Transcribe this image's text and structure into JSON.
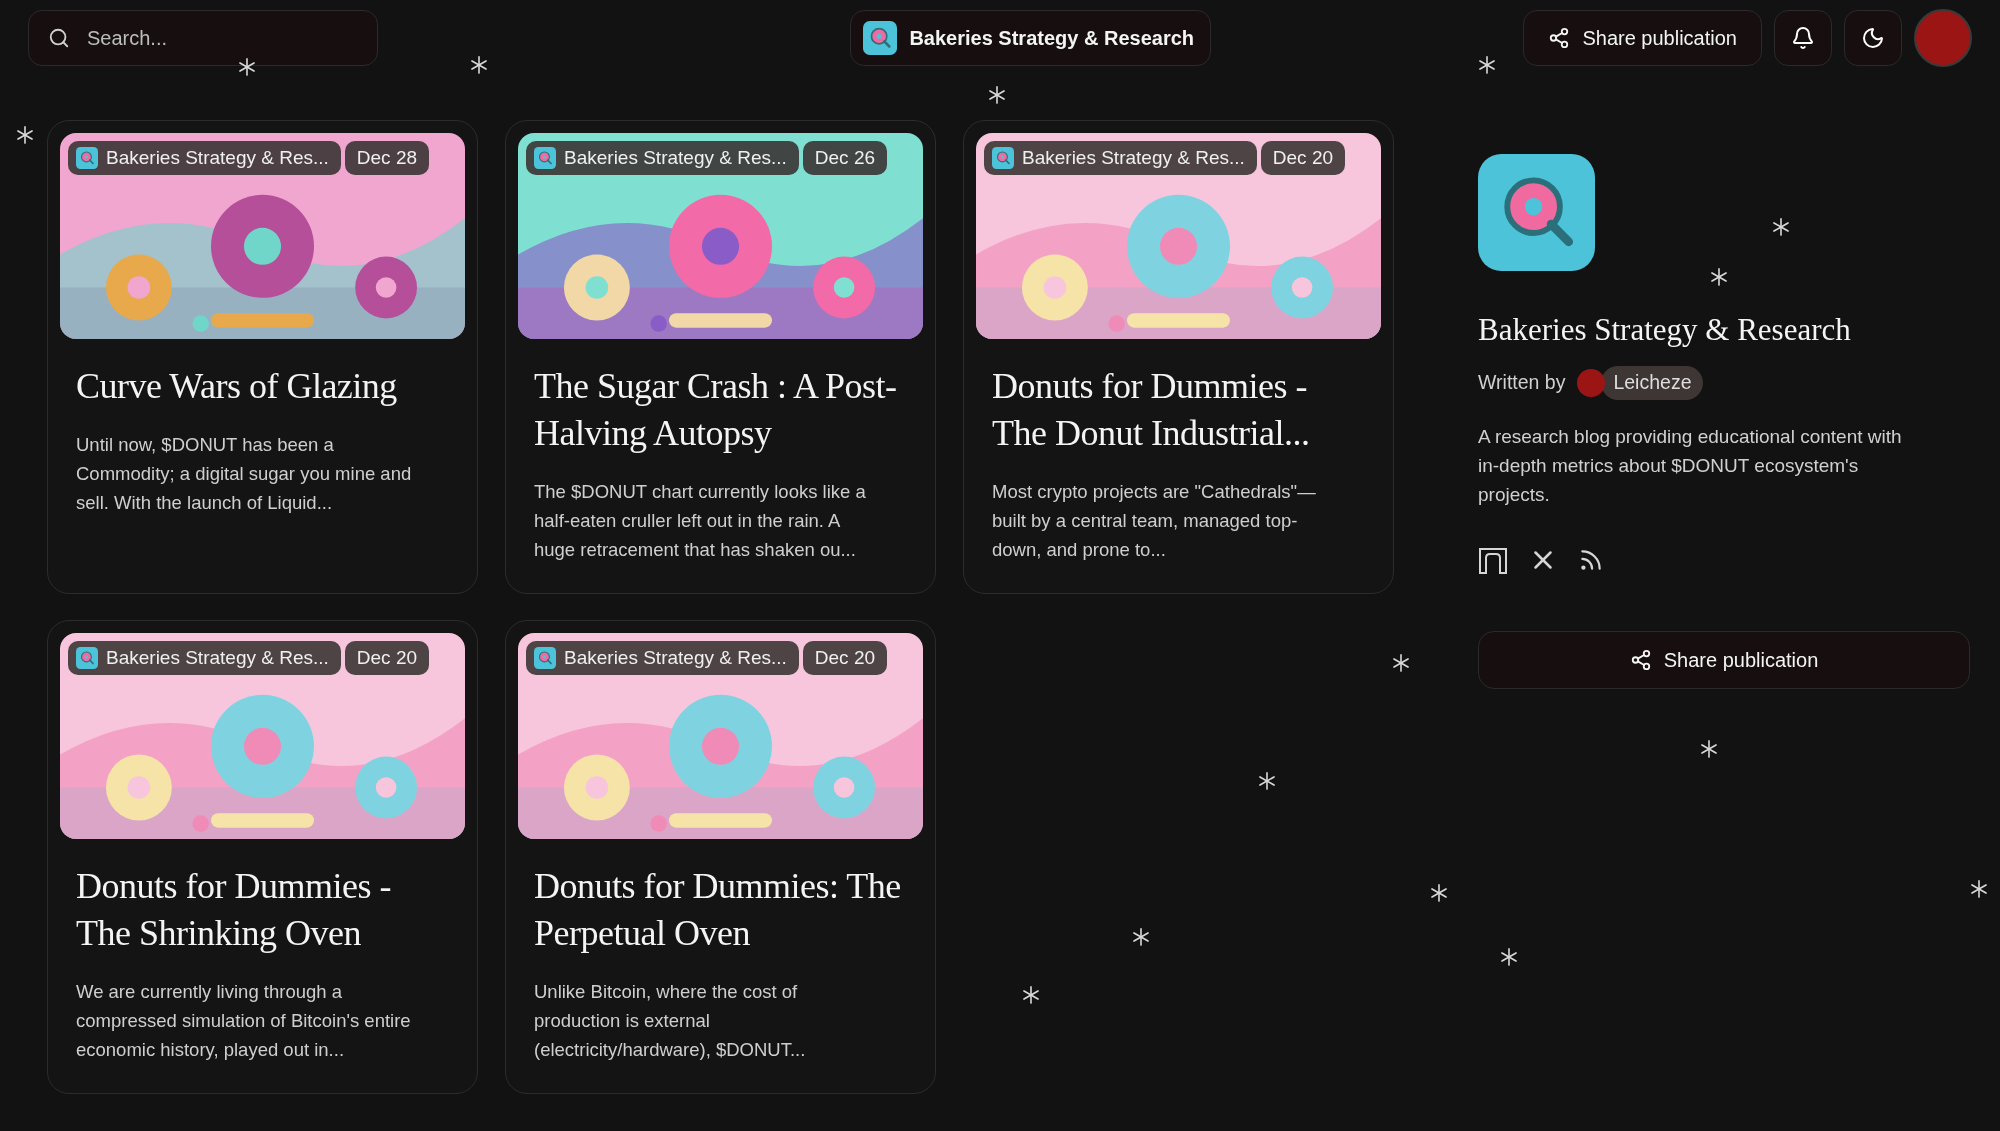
{
  "search": {
    "placeholder": "Search..."
  },
  "publication_pill": {
    "name": "Bakeries Strategy & Research"
  },
  "header_actions": {
    "share": "Share publication"
  },
  "posts": [
    {
      "publication": "Bakeries Strategy & Res...",
      "date": "Dec 28",
      "title": "Curve Wars of Glazing",
      "excerpt": "Until now, $DONUT has been a Commodity; a digital sugar you mine and sell. With the launch of Liquid..."
    },
    {
      "publication": "Bakeries Strategy & Res...",
      "date": "Dec 26",
      "title": "The Sugar Crash : A Post-Halving Autopsy",
      "excerpt": "The $DONUT chart currently looks like a half-eaten cruller left out in the rain. A huge retracement that has shaken ou..."
    },
    {
      "publication": "Bakeries Strategy & Res...",
      "date": "Dec 20",
      "title": "Donuts for Dummies - The Donut Industrial...",
      "excerpt": "Most crypto projects are \"Cathedrals\"—built by a central team, managed top-down, and prone to..."
    },
    {
      "publication": "Bakeries Strategy & Res...",
      "date": "Dec 20",
      "title": "Donuts for Dummies - The Shrinking Oven",
      "excerpt": "We are currently living through a compressed simulation of Bitcoin's entire economic history, played out in..."
    },
    {
      "publication": "Bakeries Strategy & Res...",
      "date": "Dec 20",
      "title": "Donuts for Dummies: The Perpetual Oven",
      "excerpt": "Unlike Bitcoin, where the cost of production is external (electricity/hardware), $DONUT..."
    }
  ],
  "sidebar": {
    "title": "Bakeries Strategy & Research",
    "written_by": "Written by",
    "author": "Leicheze",
    "description": "A research blog providing educational content with in-depth metrics about $DONUT ecosystem's projects.",
    "share": "Share publication"
  }
}
